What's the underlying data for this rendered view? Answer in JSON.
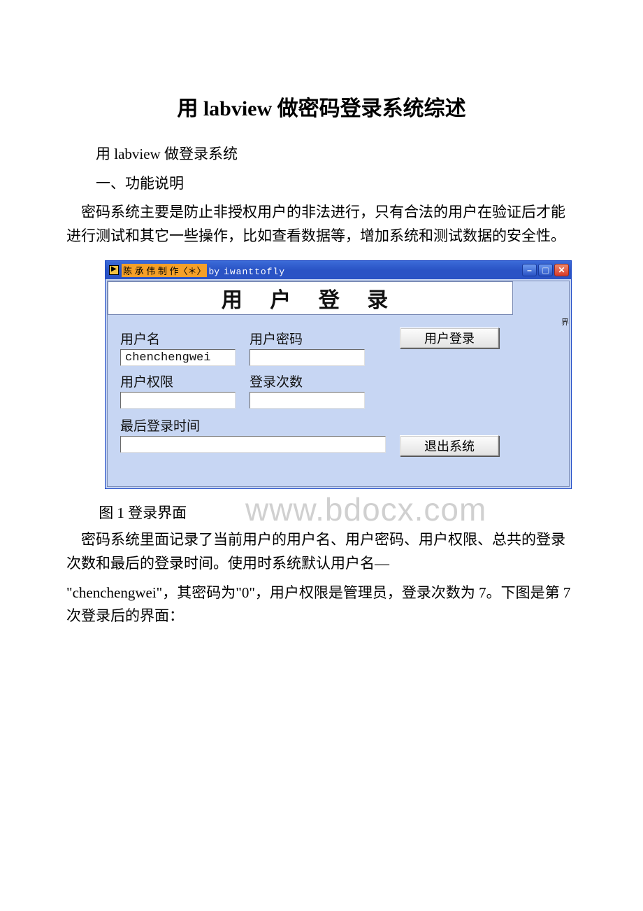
{
  "doc": {
    "title": "用 labview 做密码登录系统综述",
    "line1": "用 labview 做登录系统",
    "line2": "一、功能说明",
    "para1": "密码系统主要是防止非授权用户的非法进行，只有合法的用户在验证后才能进行测试和其它一些操作，比如查看数据等，增加系统和测试数据的安全性。",
    "caption": "图 1 登录界面",
    "para2a": "密码系统里面记录了当前用户的用户名、用户密码、用户权限、总共的登录次数和最后的登录时间。使用时系统默认用户名—",
    "para2b": "\"chenchengwei\"，其密码为\"0\"，用户权限是管理员，登录次数为 7。下图是第 7 次登录后的界面："
  },
  "win": {
    "title_seg1": "陈 承 伟 制 作〈＊〉",
    "title_by": "by",
    "title_seg2": "iwanttofly",
    "panel_title": "用 户 登 录",
    "side_clip": "界",
    "labels": {
      "username": "用户名",
      "password": "用户密码",
      "role": "用户权限",
      "count": "登录次数",
      "lasttime": "最后登录时间"
    },
    "values": {
      "username": "chenchengwei",
      "password": "",
      "role": "",
      "count": "",
      "lasttime": ""
    },
    "buttons": {
      "login": "用户登录",
      "exit": "退出系统"
    }
  },
  "watermark": "www.bdocx.com"
}
